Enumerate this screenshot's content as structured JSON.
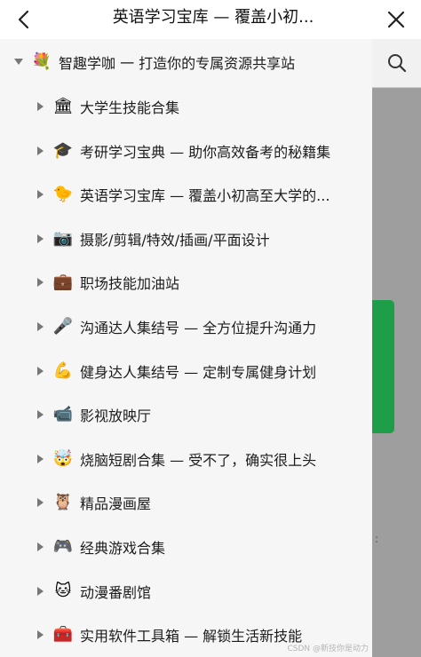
{
  "header": {
    "title": "英语学习宝库 — 覆盖小初...",
    "back_icon": "chevron-left-icon",
    "close_icon": "close-icon"
  },
  "tree": {
    "root": {
      "label": "智趣学咖 一 打造你的专属资源共享站",
      "icon": "bouquet",
      "expanded": true
    },
    "items": [
      {
        "label": "大学生技能合集",
        "icon": "🏛"
      },
      {
        "label": "考研学习宝典 — 助你高效备考的秘籍集",
        "icon": "🎓"
      },
      {
        "label": "英语学习宝库 — 覆盖小初高至大学的...",
        "icon": "🐤"
      },
      {
        "label": "摄影/剪辑/特效/插画/平面设计",
        "icon": "📷"
      },
      {
        "label": "职场技能加油站",
        "icon": "💼"
      },
      {
        "label": "沟通达人集结号 — 全方位提升沟通力",
        "icon": "🎤"
      },
      {
        "label": "健身达人集结号 — 定制专属健身计划",
        "icon": "💪"
      },
      {
        "label": "影视放映厅",
        "icon": "📹"
      },
      {
        "label": "烧脑短剧合集 — 受不了，确实很上头",
        "icon": "🤯"
      },
      {
        "label": "精品漫画屋",
        "icon": "🦉"
      },
      {
        "label": "经典游戏合集",
        "icon": "🎮"
      },
      {
        "label": "动漫番剧馆",
        "icon": "🐱"
      },
      {
        "label": "实用软件工具箱 — 解锁生活新技能",
        "icon": "🧰"
      }
    ]
  },
  "underlay": {
    "search_icon": "search-icon",
    "side_mark": ":"
  },
  "watermark": "CSDN @新技你是动力",
  "colors": {
    "drawer_bg": "#f6f6f6",
    "underlay_bg": "#9e9e9e",
    "accent_green": "#1f9e4a"
  }
}
